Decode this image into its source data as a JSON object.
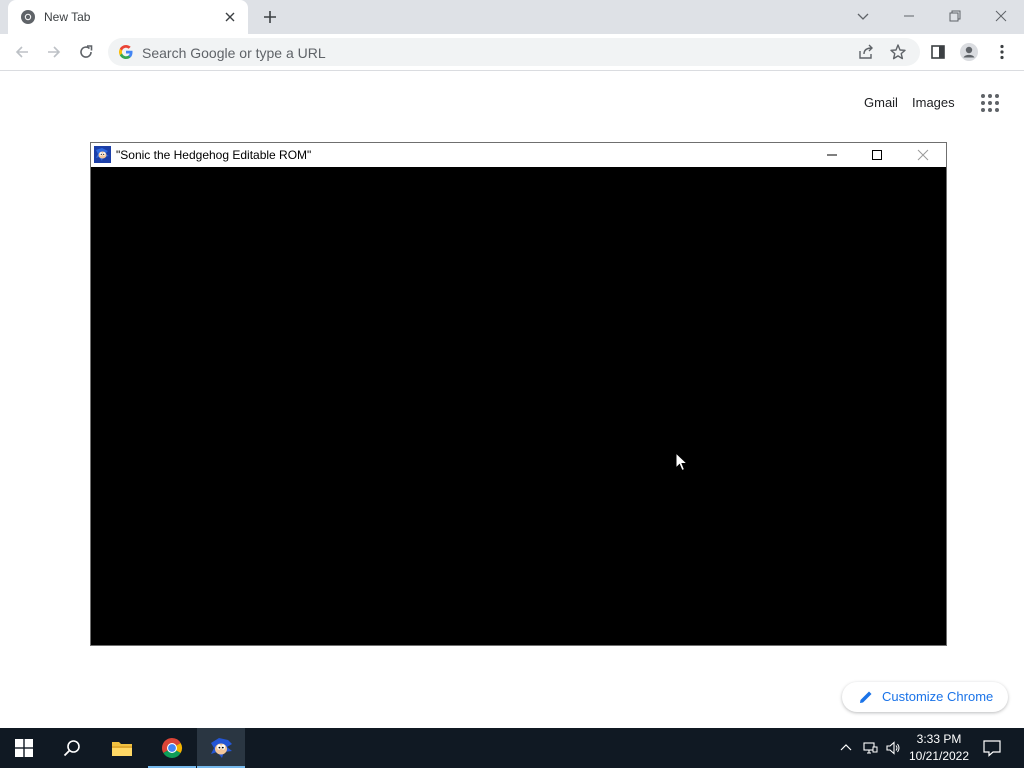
{
  "browser": {
    "tab": {
      "title": "New Tab",
      "icon": "chrome-icon"
    },
    "omnibox": {
      "placeholder": "Search Google or type a URL"
    }
  },
  "ntp": {
    "links": {
      "gmail": "Gmail",
      "images": "Images"
    },
    "customize_label": "Customize Chrome"
  },
  "emulator": {
    "title": "\"Sonic the Hedgehog Editable ROM\"",
    "icon": "sonic-icon"
  },
  "taskbar": {
    "time": "3:33 PM",
    "date": "10/21/2022",
    "pinned": [
      "start-icon",
      "search-icon",
      "file-explorer-icon",
      "chrome-icon",
      "sonic-icon"
    ]
  },
  "colors": {
    "tabstrip": "#dee1e6",
    "omnibox": "#f1f3f4",
    "link_blue": "#1a73e8",
    "taskbar": "#101923",
    "taskbar_active": "#76b9ed",
    "emulator_screen": "#000000"
  }
}
